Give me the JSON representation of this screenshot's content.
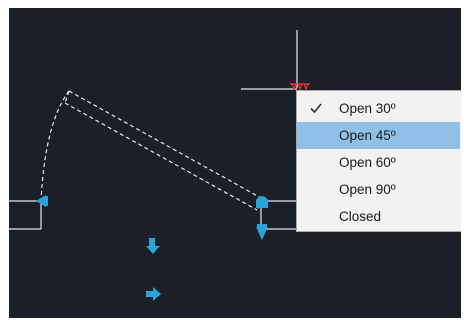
{
  "context_menu": {
    "items": [
      {
        "label": "Open 30º",
        "checked": true,
        "selected": false
      },
      {
        "label": "Open 45º",
        "checked": false,
        "selected": true
      },
      {
        "label": "Open 60º",
        "checked": false,
        "selected": false
      },
      {
        "label": "Open 90º",
        "checked": false,
        "selected": false
      },
      {
        "label": "Closed",
        "checked": false,
        "selected": false
      }
    ]
  },
  "colors": {
    "canvas_background": "#1b1f27",
    "grip_blue": "#29a3d9",
    "selection_highlight": "#8fc1e6",
    "crosshair_red": "#d9343a"
  }
}
